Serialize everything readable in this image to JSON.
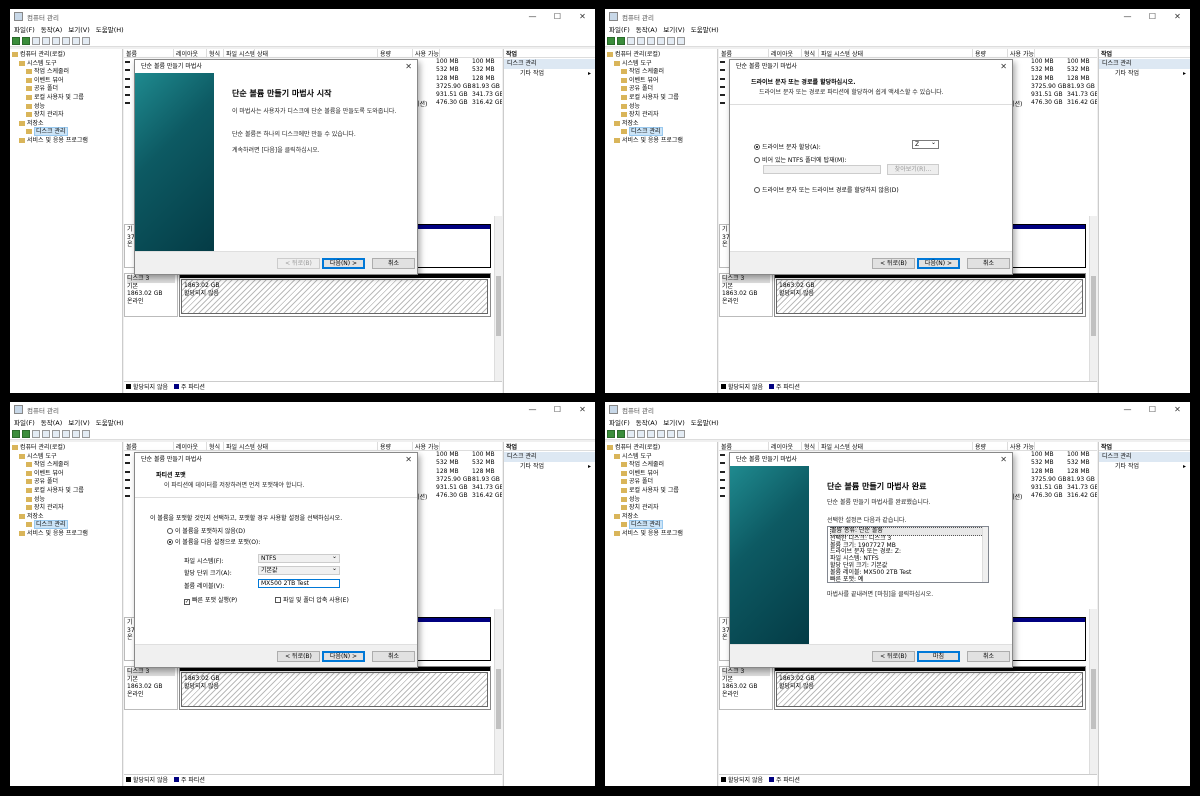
{
  "window": {
    "title": "컴퓨터 관리",
    "min": "—",
    "max": "☐",
    "close": "✕"
  },
  "menu": [
    "파일(F)",
    "동작(A)",
    "보기(V)",
    "도움말(H)"
  ],
  "tree": [
    {
      "label": "컴퓨터 관리(로컬)",
      "indent": 0
    },
    {
      "label": "시스템 도구",
      "indent": 1
    },
    {
      "label": "작업 스케줄러",
      "indent": 2
    },
    {
      "label": "이벤트 뷰어",
      "indent": 2
    },
    {
      "label": "공유 폴더",
      "indent": 2
    },
    {
      "label": "로컬 사용자 및 그룹",
      "indent": 2
    },
    {
      "label": "성능",
      "indent": 2
    },
    {
      "label": "장치 관리자",
      "indent": 2
    },
    {
      "label": "저장소",
      "indent": 1
    },
    {
      "label": "디스크 관리",
      "indent": 2,
      "selected": true
    },
    {
      "label": "서비스 및 응용 프로그램",
      "indent": 1
    }
  ],
  "columns": [
    "볼륨",
    "레이아웃",
    "형식",
    "파일 시스템",
    "상태",
    "용량",
    "사용 가능"
  ],
  "capacity": [
    "100 MB",
    "532 MB",
    "128 MB",
    "3725.90 GB",
    "931.51 GB",
    "476.30 GB"
  ],
  "free": [
    "100 MB",
    "532 MB",
    "128 MB",
    "81.93 GB",
    "341.73 GB",
    "316.42 GB"
  ],
  "fs_fragment": "티션)",
  "disk3": {
    "name": "디스크 3",
    "type": "기본",
    "size": "1863.02 GB",
    "status": "온라인",
    "part_size": "1863.02 GB",
    "part_status": "할당되지 않음"
  },
  "upper_disk": {
    "line1": "기",
    "line2": "37",
    "line3": "온"
  },
  "legend": {
    "unallocated": "할당되지 않음",
    "primary": "주 파티션"
  },
  "actions": {
    "header": "작업",
    "sub": "디스크 관리",
    "item": "기타 작업"
  },
  "wizard": {
    "title": "단순 볼륨 만들기 마법사",
    "back": "< 뒤로(B)",
    "next": "다음(N) >",
    "cancel": "취소",
    "finish": "마침",
    "s1": {
      "heading": "단순 볼륨 만들기 마법사 시작",
      "p1": "이 마법사는 사용자가 디스크에 단순 볼륨을 만들도록 도와줍니다.",
      "p2": "단순 볼륨은 하나의 디스크에만 만들 수 있습니다.",
      "p3": "계속하려면 [다음]을 클릭하십시오."
    },
    "s2": {
      "heading": "드라이브 문자 또는 경로를 할당하십시오.",
      "sub": "드라이브 문자 또는 경로로 파티션에 할당하여 쉽게 액세스할 수 있습니다.",
      "opt1": "드라이브 문자 할당(A):",
      "letter": "Z",
      "opt2": "비어 있는 NTFS 폴더에 탑재(M):",
      "browse": "찾아보기(R)...",
      "opt3": "드라이브 문자 또는 드라이브 경로를 할당하지 않음(D)"
    },
    "s3": {
      "heading": "파티션 포맷",
      "sub": "이 파티션에 데이터를 저장하려면 먼저 포맷해야 합니다.",
      "intro": "이 볼륨을 포맷할 것인지 선택하고, 포맷할 경우 사용할 설정을 선택하십시오.",
      "noformat": "이 볼륨을 포맷하지 않음(D)",
      "format": "이 볼륨을 다음 설정으로 포맷(O):",
      "fs_label": "파일 시스템(F):",
      "fs_value": "NTFS",
      "alloc_label": "할당 단위 크기(A):",
      "alloc_value": "기본값",
      "vol_label": "볼륨 레이블(V):",
      "vol_value": "MX500 2TB Test",
      "quick": "빠른 포맷 실행(P)",
      "compress": "파일 및 폴더 압축 사용(E)"
    },
    "s4": {
      "heading": "단순 볼륨 만들기 마법사 완료",
      "p1": "단순 볼륨 만들기 마법사를 완료했습니다.",
      "p2": "선택한 설정은 다음과 같습니다.",
      "list": [
        "볼륨 종류: 단순 볼륨",
        "선택한 디스크: 디스크 3",
        "볼륨 크기: 1907727 MB",
        "드라이브 문자 또는 경로: Z:",
        "파일 시스템: NTFS",
        "할당 단위 크기: 기본값",
        "볼륨 레이블: MX500 2TB Test",
        "빠른 포맷: 예"
      ],
      "p3": "마법사를 끝내려면 [마침]을 클릭하십시오."
    }
  },
  "colors": {
    "unallocated": "#000000",
    "primary": "#000080",
    "panel": "#0d5a63"
  }
}
